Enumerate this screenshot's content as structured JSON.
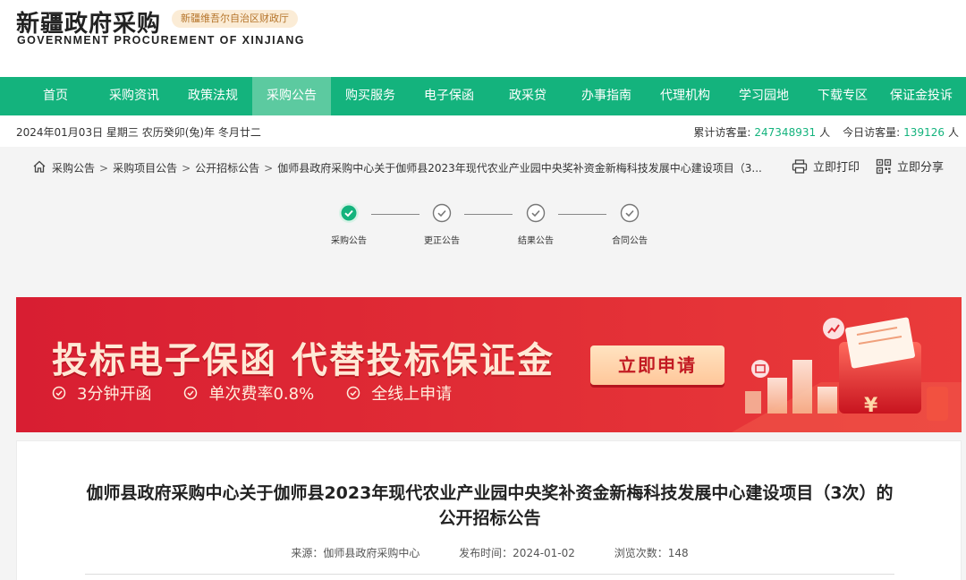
{
  "header": {
    "logo_cn": "新疆政府采购",
    "badge": "新疆维吾尔自治区财政厅",
    "logo_en": "GOVERNMENT PROCUREMENT OF XINJIANG"
  },
  "nav": {
    "items": [
      {
        "label": "首页"
      },
      {
        "label": "采购资讯"
      },
      {
        "label": "政策法规"
      },
      {
        "label": "采购公告"
      },
      {
        "label": "购买服务"
      },
      {
        "label": "电子保函"
      },
      {
        "label": "政采贷"
      },
      {
        "label": "办事指南"
      },
      {
        "label": "代理机构"
      },
      {
        "label": "学习园地"
      },
      {
        "label": "下载专区"
      },
      {
        "label": "保证金投诉"
      }
    ],
    "active_index": 3
  },
  "infobar": {
    "date": "2024年01月03日 星期三 农历癸卯(兔)年 冬月廿二",
    "total_label": "累计访客量:",
    "total_value": "247348931",
    "total_unit": "人",
    "today_label": "今日访客量:",
    "today_value": "139126",
    "today_unit": "人"
  },
  "breadcrumb": {
    "items": [
      "采购公告",
      "采购项目公告",
      "公开招标公告",
      "伽师县政府采购中心关于伽师县2023年现代农业产业园中央奖补资金新梅科技发展中心建设项目（3..."
    ],
    "separator": ">",
    "print_label": "立即打印",
    "share_label": "立即分享"
  },
  "stepper": {
    "steps": [
      {
        "label": "采购公告",
        "state": "active"
      },
      {
        "label": "更正公告",
        "state": "done"
      },
      {
        "label": "结果公告",
        "state": "done"
      },
      {
        "label": "合同公告",
        "state": "done"
      }
    ]
  },
  "banner": {
    "title": "投标电子保函 代替投标保证金",
    "features": [
      "3分钟开函",
      "单次费率0.8%",
      "全线上申请"
    ],
    "cta": "立即申请"
  },
  "article": {
    "title": "伽师县政府采购中心关于伽师县2023年现代农业产业园中央奖补资金新梅科技发展中心建设项目（3次）的公开招标公告",
    "source": "来源：伽师县政府采购中心",
    "publish_time": "发布时间：2024-01-02",
    "views": "浏览次数：148"
  },
  "colors": {
    "primary_green": "#14b37d",
    "active_nav": "#5ccaa0",
    "banner_red": "#e02b35",
    "cta_text": "#c21a22"
  }
}
